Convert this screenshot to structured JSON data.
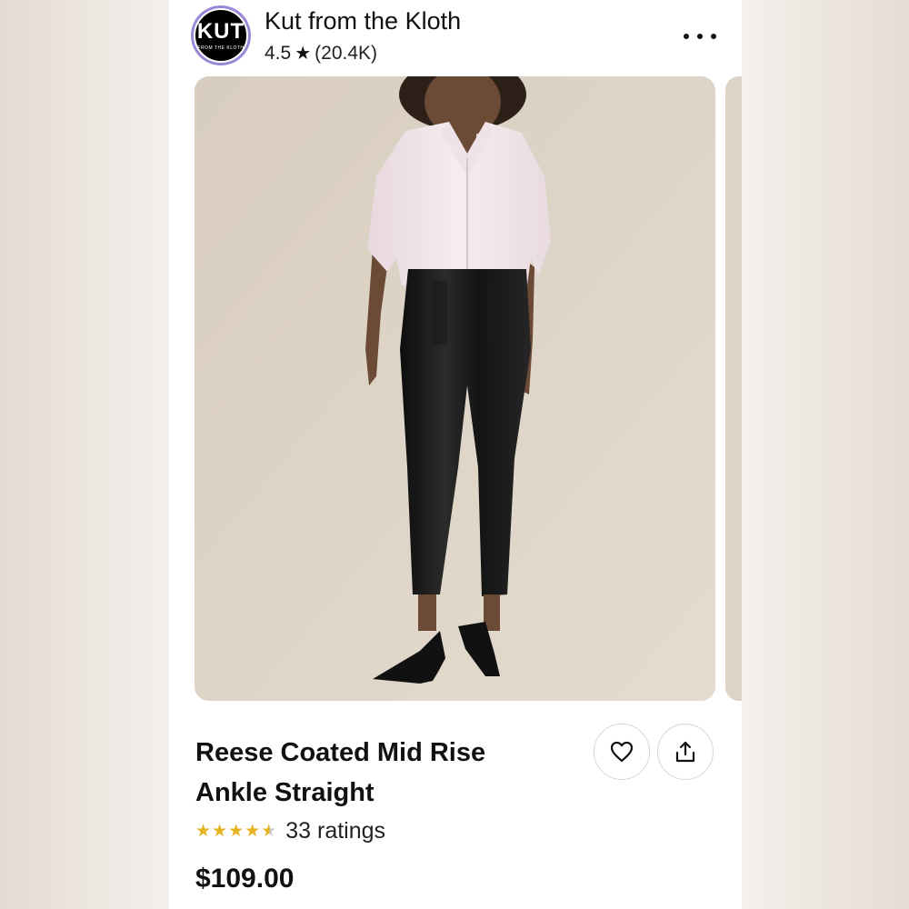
{
  "shop": {
    "name": "Kut from the Kloth",
    "rating": "4.5",
    "review_count": "(20.4K)",
    "logo_text": "KUT",
    "logo_subtext": "FROM THE KLOTH"
  },
  "product": {
    "title": "Reese Coated Mid Rise Ankle Straight",
    "ratings_label": "33 ratings",
    "star_rating": 4.5,
    "price": "$109.00"
  },
  "icons": {
    "more": "more-horizontal-icon",
    "favorite": "heart-icon",
    "share": "share-icon",
    "rating": "star-icon"
  },
  "colors": {
    "star": "#e5b31f",
    "logo_ring": "#9a86d6",
    "image_background": "#ddd3c6"
  }
}
